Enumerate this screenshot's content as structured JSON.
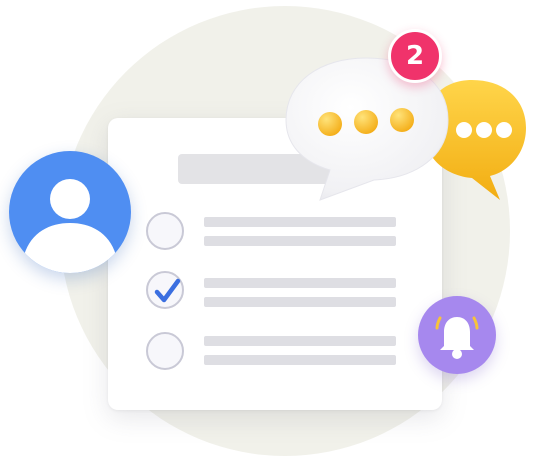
{
  "notification": {
    "badge_count": "2",
    "badge_color": "#f0336b"
  },
  "icons": {
    "avatar": "user-avatar-icon",
    "chat_main": "speech-bubble-icon",
    "chat_secondary": "speech-bubble-icon",
    "bell": "bell-icon",
    "check": "checkmark-icon"
  },
  "checklist": {
    "items": [
      {
        "checked": false
      },
      {
        "checked": true
      },
      {
        "checked": false
      }
    ]
  },
  "colors": {
    "avatar_bg": "#4f8ef2",
    "chat_main_dots": "#f7b81e",
    "chat_secondary_bg": "#f9c21f",
    "bell_bg": "#a688ee",
    "check_color": "#3b6fe0",
    "background_circle": "#f1f1ea"
  }
}
